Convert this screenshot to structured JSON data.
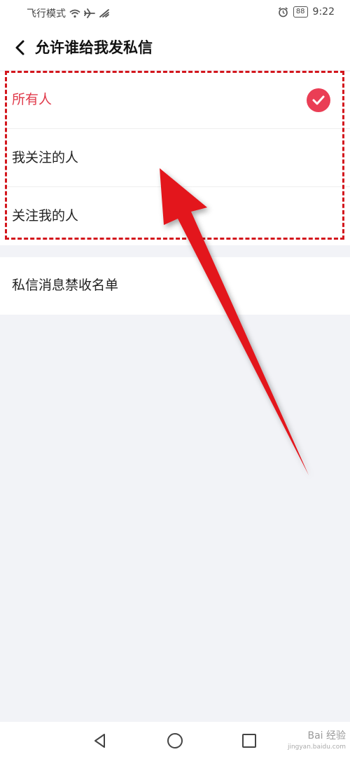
{
  "status_bar": {
    "mode_text": "飞行模式",
    "battery": "88",
    "time": "9:22"
  },
  "header": {
    "title": "允许谁给我发私信"
  },
  "options": [
    {
      "label": "所有人",
      "selected": true
    },
    {
      "label": "我关注的人",
      "selected": false
    },
    {
      "label": "关注我的人",
      "selected": false
    }
  ],
  "blacklist": {
    "label": "私信消息禁收名单"
  },
  "watermark": {
    "brand": "Bai 经验",
    "url": "jingyan.baidu.com"
  },
  "colors": {
    "accent": "#ea3e55",
    "annotation": "#d3161d",
    "background": "#f2f3f7"
  }
}
